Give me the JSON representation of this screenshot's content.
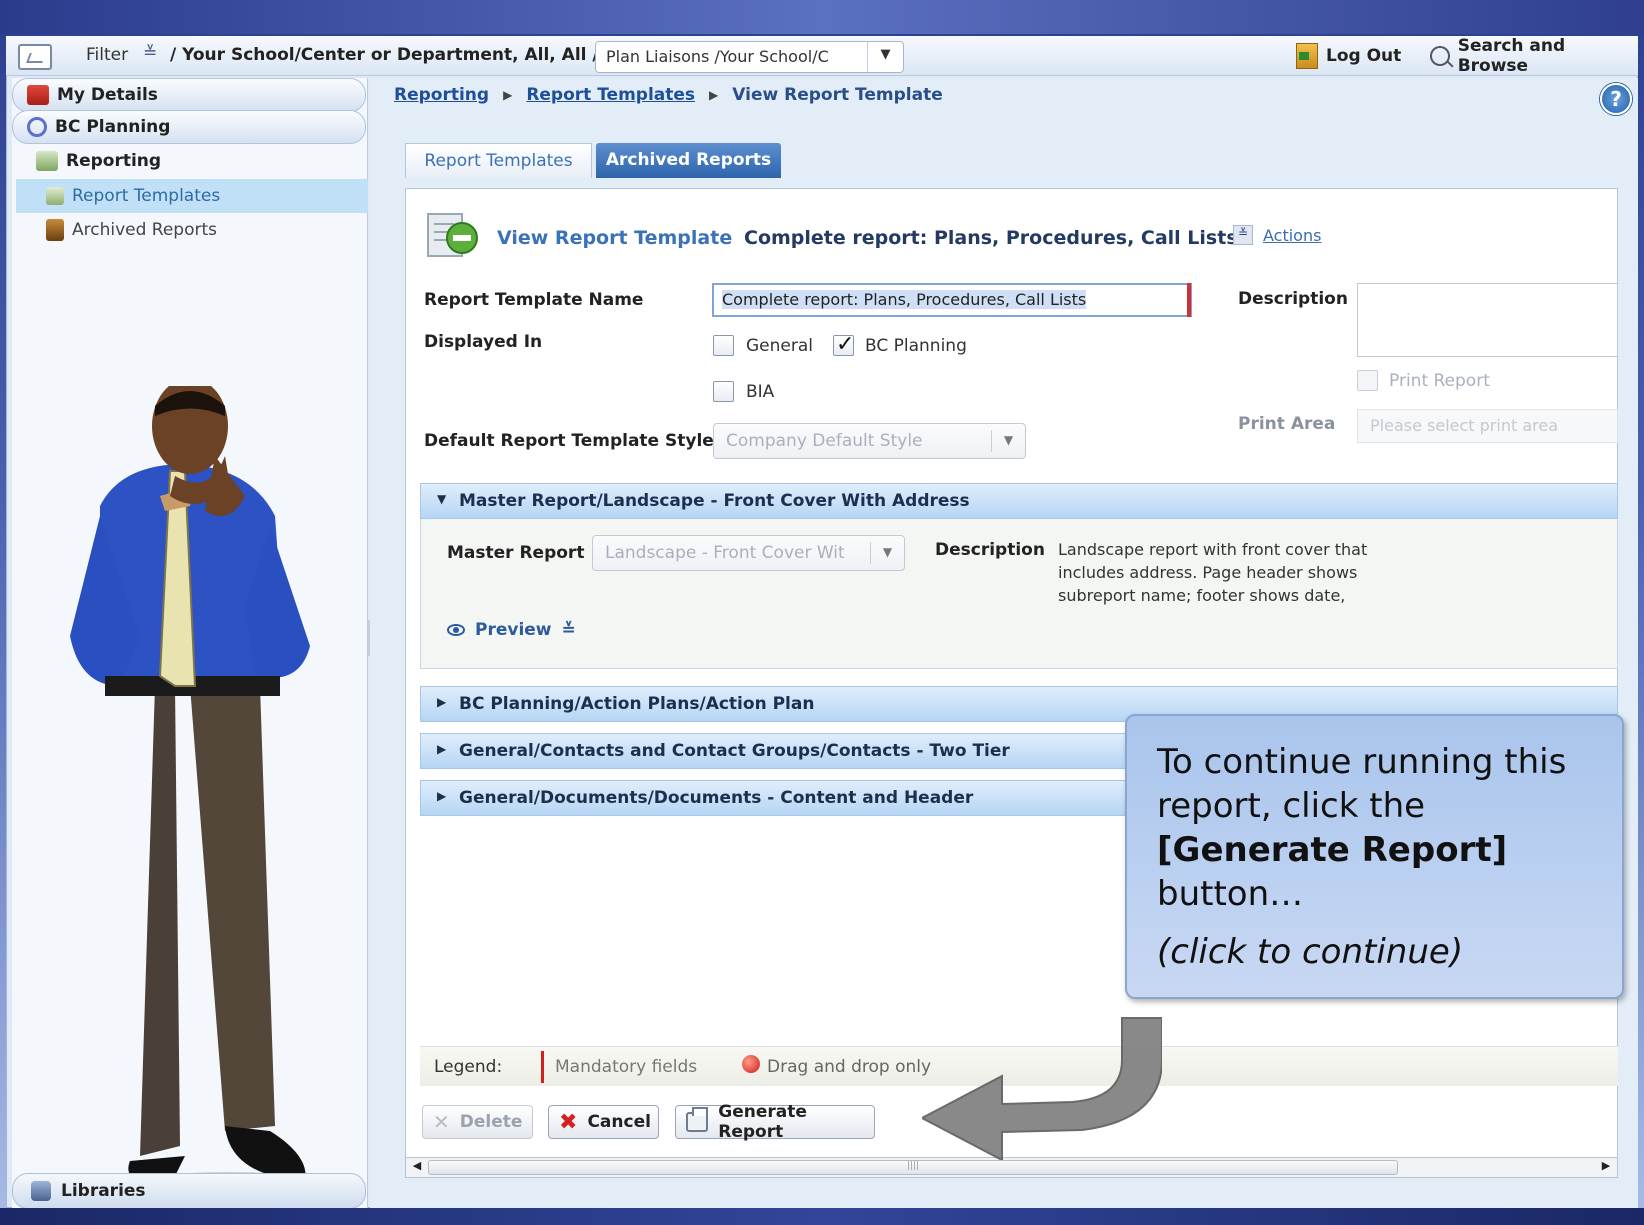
{
  "topbar": {
    "filter_label": "Filter",
    "filter_path": "/ Your School/Center or Department, All, All /",
    "plan_select": "Plan Liaisons /Your School/C",
    "logout": "Log Out",
    "search": "Search and Browse"
  },
  "sidebar": {
    "my_details": "My Details",
    "bc_planning": "BC Planning",
    "reporting": "Reporting",
    "report_templates": "Report Templates",
    "archived_reports": "Archived Reports",
    "libraries": "Libraries"
  },
  "breadcrumb": {
    "reporting": "Reporting",
    "report_templates": "Report Templates",
    "current": "View Report Template"
  },
  "tabs": {
    "report_templates": "Report Templates",
    "archived_reports": "Archived Reports"
  },
  "header": {
    "title": "View Report Template",
    "subtitle": "Complete report: Plans, Procedures, Call Lists",
    "actions": "Actions"
  },
  "form": {
    "name_label": "Report Template Name",
    "name_value": "Complete report: Plans, Procedures, Call Lists",
    "description_label": "Description",
    "displayed_in_label": "Displayed In",
    "opt_general": "General",
    "opt_bc_planning": "BC Planning",
    "opt_bia": "BIA",
    "print_report": "Print Report",
    "print_area_label": "Print Area",
    "print_area_placeholder": "Please select print area",
    "style_label": "Default Report Template Style",
    "style_value": "Company Default Style"
  },
  "sections": {
    "master": "Master Report/Landscape - Front Cover With Address",
    "master_report_label": "Master Report",
    "master_report_value": "Landscape - Front Cover Wit",
    "description_label": "Description",
    "description_text": "Landscape report with front cover that includes address. Page header shows subreport name; footer shows date,",
    "preview": "Preview",
    "s2": "BC Planning/Action Plans/Action Plan",
    "s3": "General/Contacts and Contact Groups/Contacts - Two Tier",
    "s4": "General/Documents/Documents - Content and Header"
  },
  "legend": {
    "label": "Legend:",
    "mandatory": "Mandatory fields",
    "drag": "Drag and drop only"
  },
  "buttons": {
    "delete": "Delete",
    "cancel": "Cancel",
    "generate": "Generate Report"
  },
  "callout": {
    "line1": "To continue running this report, click the",
    "bold": "[Generate Report]",
    "line2": "button…",
    "italic": "(click to continue)"
  },
  "colors": {
    "accent": "#2e64ab",
    "link": "#1f4f9a",
    "mandatory": "#d02020"
  }
}
